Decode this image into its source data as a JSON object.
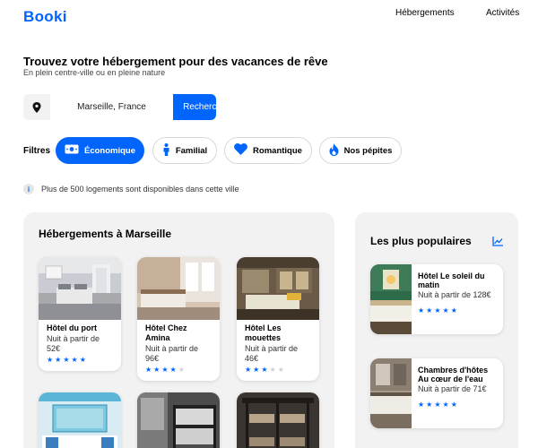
{
  "header": {
    "logo": "Booki",
    "nav": [
      "Hébergements",
      "Activités"
    ]
  },
  "hero": {
    "title": "Trouvez votre hébergement pour des vacances de rêve",
    "subtitle": "En plein centre-ville ou en pleine nature"
  },
  "search": {
    "value": "Marseille, France",
    "button_label": "Rechercher",
    "icon": "location-pin-icon"
  },
  "filters": {
    "label": "Filtres",
    "items": [
      {
        "label": "Économique",
        "icon": "money-icon",
        "active": true
      },
      {
        "label": "Familial",
        "icon": "person-icon",
        "active": false
      },
      {
        "label": "Romantique",
        "icon": "heart-icon",
        "active": false
      },
      {
        "label": "Nos pépites",
        "icon": "fire-icon",
        "active": false
      }
    ]
  },
  "info": {
    "icon_text": "i",
    "text": "Plus de 500 logements sont disponibles dans cette ville"
  },
  "accommodations": {
    "title": "Hébergements à Marseille",
    "cards": [
      {
        "name": "Hôtel du port",
        "price": "Nuit à partir de 52€",
        "rating": 5
      },
      {
        "name": "Hôtel Chez Amina",
        "price": "Nuit à partir de 96€",
        "rating": 4
      },
      {
        "name": "Hôtel Les mouettes",
        "price": "Nuit à partir de 46€",
        "rating": 3
      }
    ]
  },
  "popular": {
    "title": "Les plus populaires",
    "icon": "trend-chart-icon",
    "items": [
      {
        "name": "Hôtel Le soleil du matin",
        "price": "Nuit à partir de 128€",
        "rating": 5
      },
      {
        "name": "Chambres d'hôtes Au cœur de l'eau",
        "price": "Nuit à partir de 71€",
        "rating": 5
      }
    ]
  },
  "colors": {
    "brand": "#0065fc",
    "panel_bg": "#f2f2f2",
    "star_off": "#d0d0d0"
  }
}
